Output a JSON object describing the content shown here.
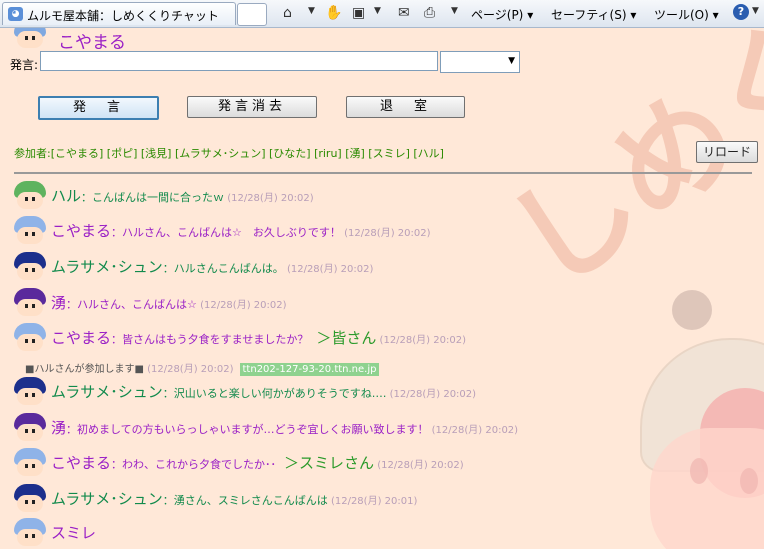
{
  "browser": {
    "tab_title": "ムルモ屋本舗：しめくくりチャット",
    "menus": {
      "page": "ページ(P)",
      "safety": "セーフティ(S)",
      "tools": "ツール(O)"
    }
  },
  "header": {
    "user_name": "こやまる"
  },
  "form": {
    "say_label": "発言:",
    "input_value": "",
    "buttons": {
      "say": "発　言",
      "clear": "発言消去",
      "leave": "退　室"
    }
  },
  "participants": {
    "label": "参加者:",
    "list": "[こやまる] [ポピ] [浅見] [ムラサメ･シュン] [ひなた] [riru] [湧] [スミレ] [ハル]",
    "reload": "リロード"
  },
  "watermark": "しめくく",
  "colors": {
    "page_bg": "#ffe8d8",
    "message_text": "#7a18b8",
    "time": "#b89eb8",
    "members": "#2a8a00"
  },
  "messages": [
    {
      "name": "ハル",
      "text": "：こんばんは一間に合ったｗ",
      "time": "(12/28(月) 20:02)",
      "name_color": "#118a4c",
      "text_color": "#118a4c",
      "avatar": "green"
    },
    {
      "name": "こやまる",
      "text": "：ハルさん、こんばんは☆　お久しぶりです！",
      "time": "(12/28(月) 20:02)",
      "name_color": "#9a1fc6",
      "text_color": "#9a1fc6",
      "avatar": "pink"
    },
    {
      "name": "ムラサメ･シュン",
      "text": "：ハルさんこんばんは。",
      "time": "(12/28(月) 20:02)",
      "name_color": "#118a4c",
      "text_color": "#118a4c",
      "avatar": "navy"
    },
    {
      "name": "湧",
      "text": "：ハルさん、こんばんは☆",
      "time": "(12/28(月) 20:02)",
      "name_color": "#9a1fc6",
      "text_color": "#9a1fc6",
      "avatar": "purple"
    },
    {
      "name": "こやまる",
      "text": "：皆さんはもう夕食をすませましたか？",
      "extra": "＞皆さん",
      "time": "(12/28(月) 20:02)",
      "name_color": "#9a1fc6",
      "text_color": "#9a1fc6",
      "avatar": "pink"
    },
    {
      "system": true,
      "text": "■ハルさんが参加します■",
      "time": "(12/28(月) 20:02)",
      "host": "ttn202-127-93-20.ttn.ne.jp"
    },
    {
      "name": "ムラサメ･シュン",
      "text": "：沢山いると楽しい何かがありそうですね‥‥",
      "time": "(12/28(月) 20:02)",
      "name_color": "#118a4c",
      "text_color": "#118a4c",
      "avatar": "navy"
    },
    {
      "name": "湧",
      "text": "：初めましての方もいらっしゃいますが…どうぞ宜しくお願い致します！",
      "time": "(12/28(月) 20:02)",
      "name_color": "#9a1fc6",
      "text_color": "#9a1fc6",
      "avatar": "purple"
    },
    {
      "name": "こやまる",
      "text": "：わわ、これから夕食でしたか･･",
      "extra": "＞スミレさん",
      "time": "(12/28(月) 20:02)",
      "name_color": "#9a1fc6",
      "text_color": "#9a1fc6",
      "avatar": "pink"
    },
    {
      "name": "ムラサメ･シュン",
      "text": "：湧さん、スミレさんこんばんは",
      "time": "(12/28(月) 20:01)",
      "name_color": "#118a4c",
      "text_color": "#118a4c",
      "avatar": "navy"
    },
    {
      "name": "スミレ",
      "text": "",
      "time": "",
      "name_color": "#9a1fc6",
      "text_color": "#9a1fc6",
      "avatar": "pink"
    }
  ]
}
